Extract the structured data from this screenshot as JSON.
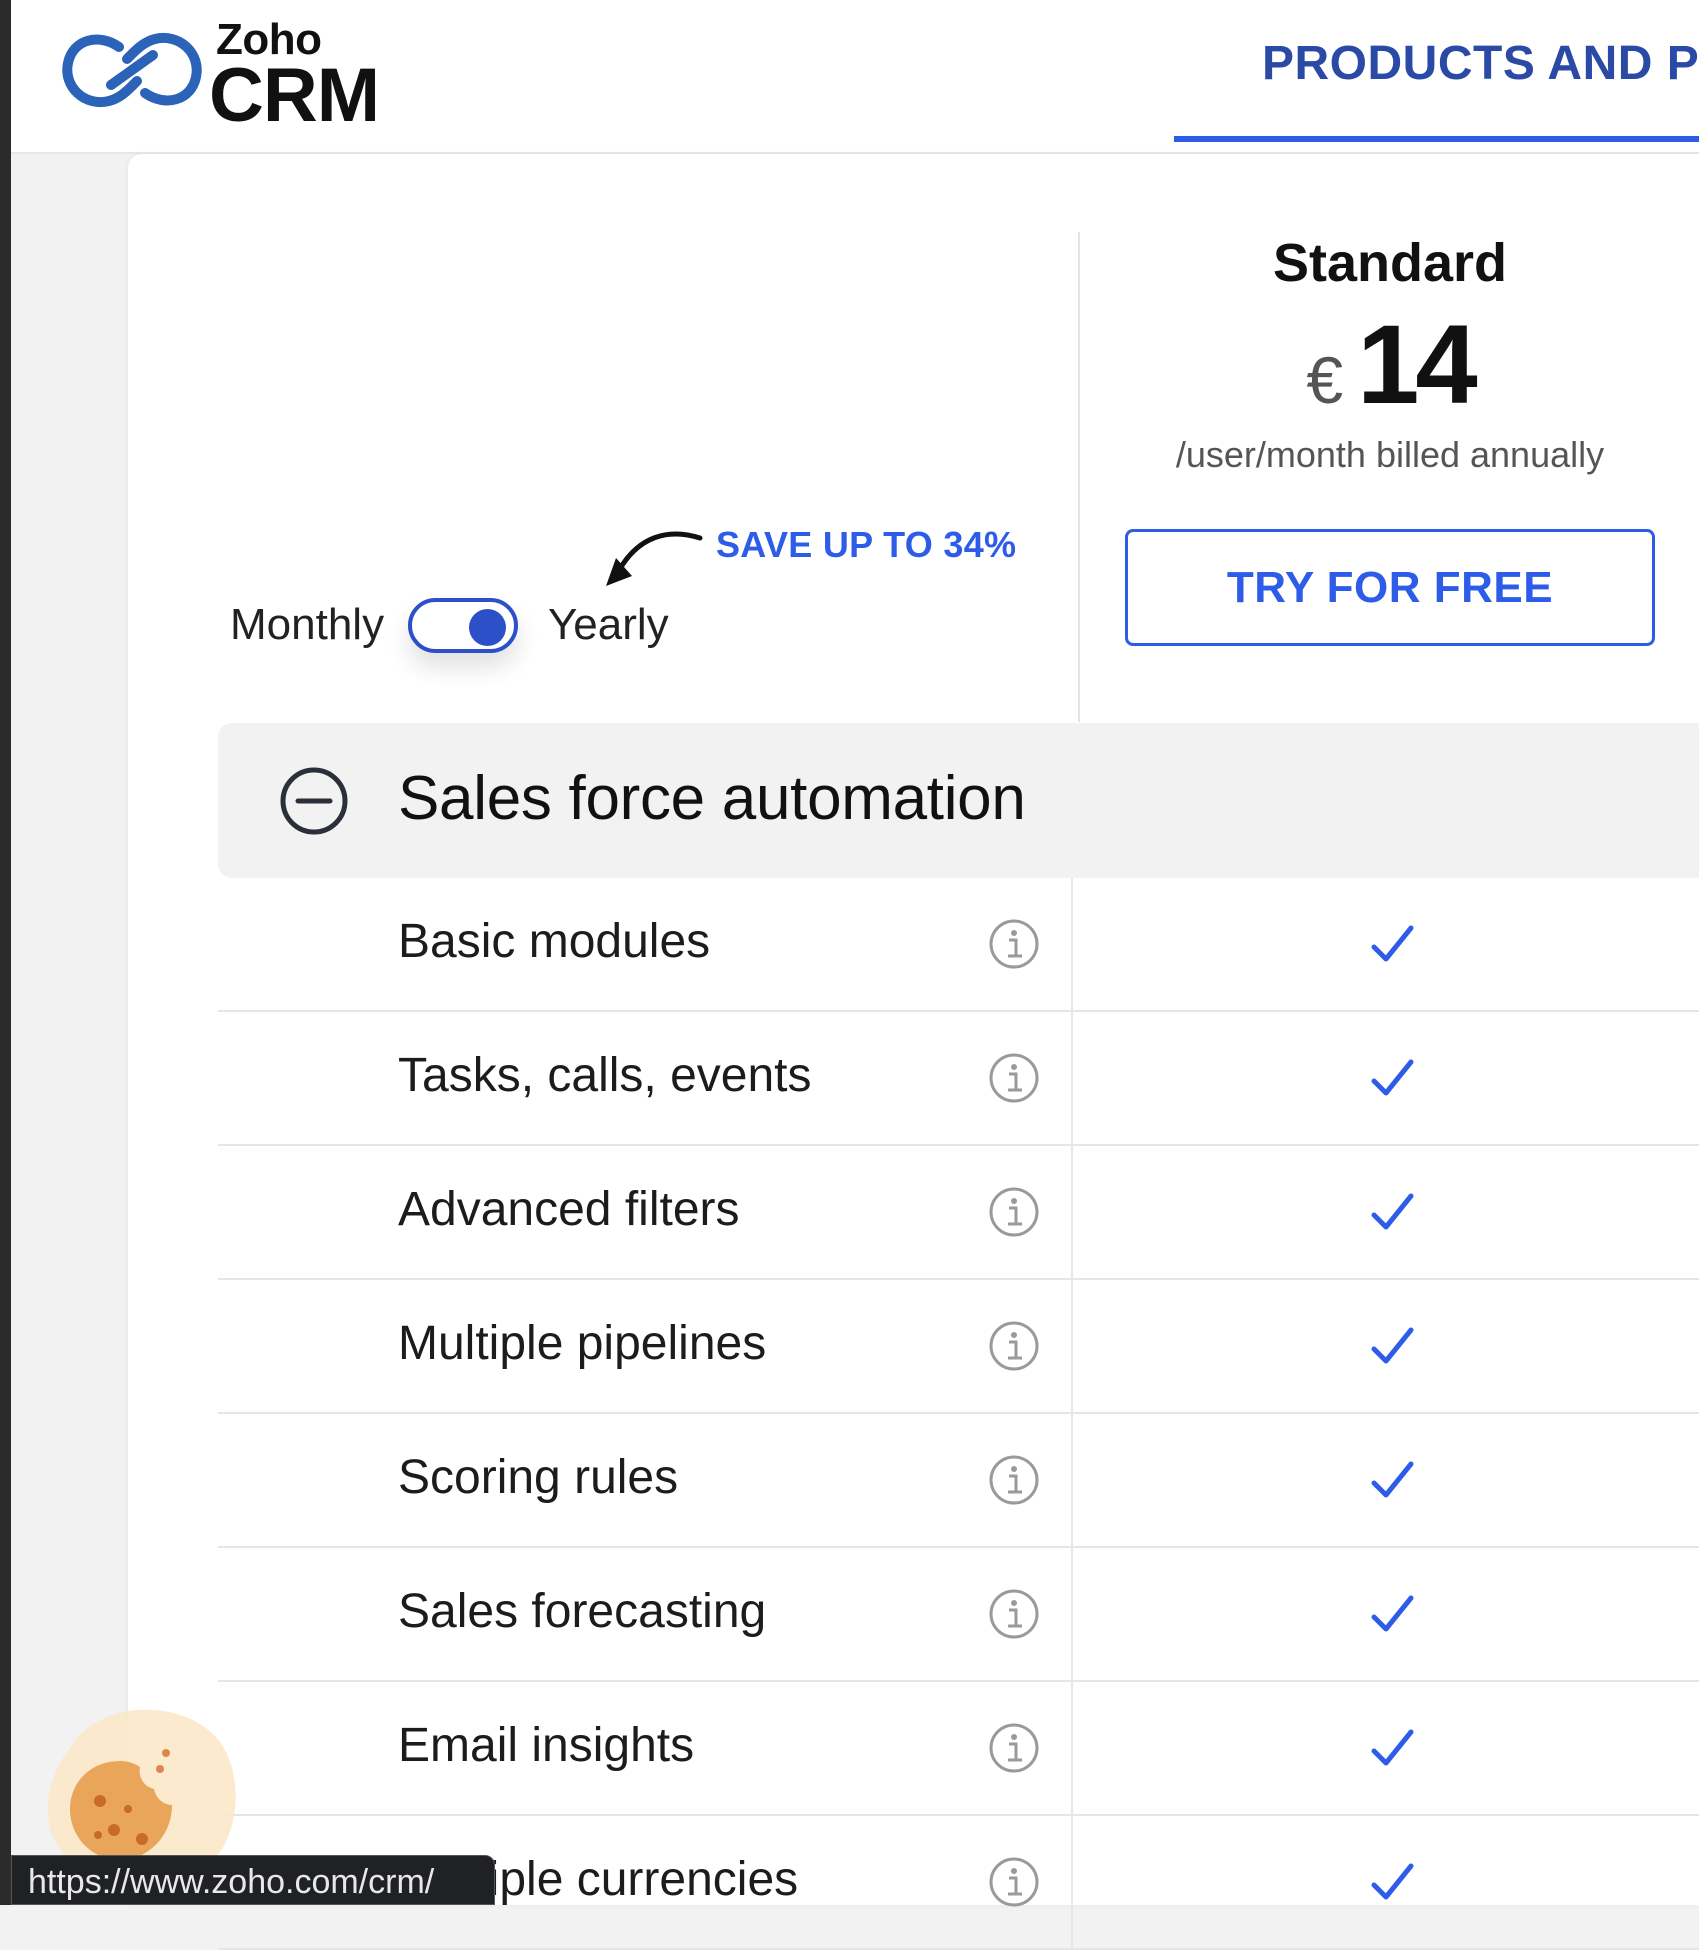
{
  "header": {
    "logo_brand": "Zoho",
    "logo_product": "CRM",
    "nav_tab_label": "PRODUCTS AND PL"
  },
  "plan": {
    "name": "Standard",
    "currency": "€",
    "price": "14",
    "billing_note": "/user/month billed annually",
    "cta_label": "TRY FOR FREE"
  },
  "billing_toggle": {
    "left_label": "Monthly",
    "right_label": "Yearly",
    "selected": "Yearly",
    "save_badge": "SAVE UP TO 34%"
  },
  "section": {
    "title": "Sales force automation",
    "features": [
      {
        "label": "Basic modules",
        "included": true
      },
      {
        "label": "Tasks, calls, events",
        "included": true
      },
      {
        "label": "Advanced filters",
        "included": true
      },
      {
        "label": "Multiple pipelines",
        "included": true
      },
      {
        "label": "Scoring rules",
        "included": true
      },
      {
        "label": "Sales forecasting",
        "included": true
      },
      {
        "label": "Email insights",
        "included": true
      },
      {
        "label": "Multiple currencies",
        "included": true
      }
    ]
  },
  "status_bar": {
    "url": "https://www.zoho.com/crm/"
  },
  "colors": {
    "accent": "#2d5ce8",
    "nav_text": "#2a4aa6",
    "toggle": "#2d4fc8",
    "section_bg": "#f2f2f2"
  },
  "icons": [
    "zoho-logo-icon",
    "minus-circle-icon",
    "info-icon",
    "check-icon",
    "curved-arrow-icon",
    "cookie-icon"
  ]
}
